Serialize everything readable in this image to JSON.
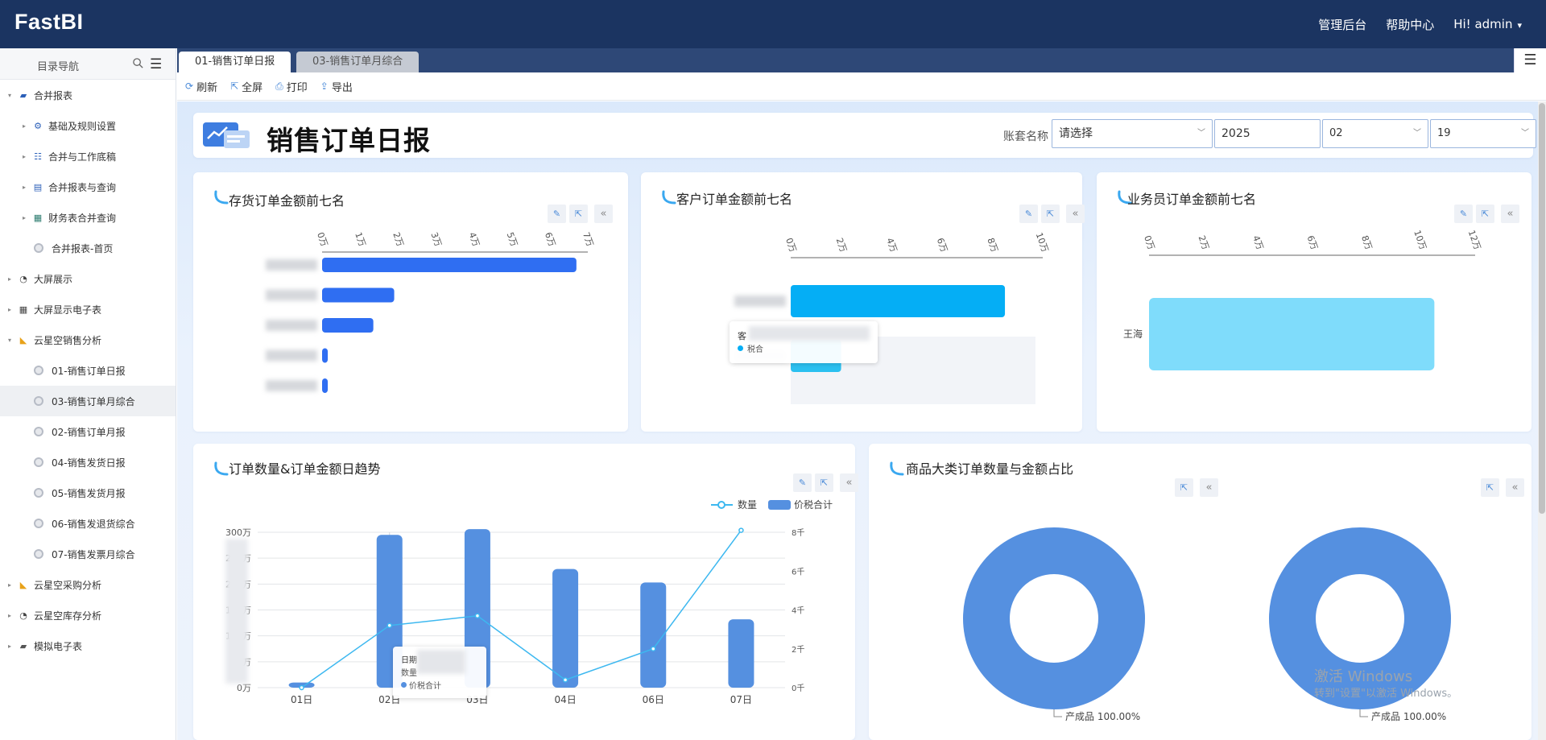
{
  "header": {
    "logo": "FastBI",
    "admin_console": "管理后台",
    "help_center": "帮助中心",
    "greeting": "Hi!  admin"
  },
  "sidebar": {
    "title": "目录导航",
    "items": [
      {
        "label": "合并报表",
        "level": 0,
        "expanded": true,
        "icon": "folder-open-icon"
      },
      {
        "label": "基础及规则设置",
        "level": 1,
        "icon": "gear-icon"
      },
      {
        "label": "合并与工作底稿",
        "level": 1,
        "icon": "sliders-icon"
      },
      {
        "label": "合并报表与查询",
        "level": 1,
        "icon": "document-icon"
      },
      {
        "label": "财务表合并查询",
        "level": 1,
        "icon": "spreadsheet-icon"
      },
      {
        "label": "合并报表-首页",
        "level": 1,
        "icon": "page-icon"
      },
      {
        "label": "大屏展示",
        "level": 0,
        "icon": "pie-chart-icon"
      },
      {
        "label": "大屏显示电子表",
        "level": 0,
        "icon": "grid-icon"
      },
      {
        "label": "云星空销售分析",
        "level": 0,
        "expanded": true,
        "icon": "area-chart-icon"
      },
      {
        "label": "01-销售订单日报",
        "level": 1,
        "icon": "page-icon"
      },
      {
        "label": "03-销售订单月综合",
        "level": 1,
        "icon": "page-icon",
        "selected": true
      },
      {
        "label": "02-销售订单月报",
        "level": 1,
        "icon": "page-icon"
      },
      {
        "label": "04-销售发货日报",
        "level": 1,
        "icon": "page-icon"
      },
      {
        "label": "05-销售发货月报",
        "level": 1,
        "icon": "page-icon"
      },
      {
        "label": "06-销售发退货综合",
        "level": 1,
        "icon": "page-icon"
      },
      {
        "label": "07-销售发票月综合",
        "level": 1,
        "icon": "page-icon"
      },
      {
        "label": "云星空采购分析",
        "level": 0,
        "icon": "area-chart-icon"
      },
      {
        "label": "云星空库存分析",
        "level": 0,
        "icon": "pie-chart-icon"
      },
      {
        "label": "模拟电子表",
        "level": 0,
        "icon": "folder-icon"
      }
    ]
  },
  "tabs": [
    {
      "label": "01-销售订单日报",
      "active": true
    },
    {
      "label": "03-销售订单月综合",
      "active": false
    }
  ],
  "toolbar": {
    "refresh": "刷新",
    "fullscreen": "全屏",
    "print": "打印",
    "export": "导出"
  },
  "report": {
    "title": "销售订单日报",
    "filters": {
      "account_label": "账套名称",
      "account_placeholder": "请选择",
      "year": "2025",
      "month": "02",
      "day": "19"
    }
  },
  "cards": {
    "inventory_title": "存货订单金额前七名",
    "customer_title": "客户订单金额前七名",
    "salesperson_title": "业务员订单金额前七名",
    "trend_title": "订单数量&订单金额日趋势",
    "category_title": "商品大类订单数量与金额占比"
  },
  "tooltips": {
    "customer": {
      "name": "客",
      "series": "税合"
    },
    "trend": {
      "date": "日期",
      "qty": "数量",
      "amount": "价税合计"
    }
  },
  "colors": {
    "header_bg": "#1b3461",
    "tabbar_bg": "#2e4877",
    "bar_blue": "#2f6ef2",
    "bar_cyan": "#05aef5",
    "bar_light_cyan": "#7fdcfb",
    "trend_bar": "#5590e0",
    "trend_line": "#3db8f0",
    "donut": "#5590e0"
  },
  "chart_data": [
    {
      "type": "bar",
      "title": "存货订单金额前七名",
      "orientation": "horizontal",
      "categories": [
        "■■■■机",
        "■■■■",
        "■■■■■",
        "■■■■■线",
        "■■■■■长线"
      ],
      "values": [
        67000,
        19000,
        13500,
        1500,
        1500
      ],
      "xticks": [
        "0万",
        "1万",
        "2万",
        "3万",
        "4万",
        "5万",
        "6万",
        "7万"
      ],
      "xlim": [
        0,
        70000
      ]
    },
    {
      "type": "bar",
      "title": "客户订单金额前七名",
      "orientation": "horizontal",
      "categories": [
        "■■■■■■■■司",
        "■■■■■■■■■■"
      ],
      "values": [
        85000,
        20000
      ],
      "xticks": [
        "0万",
        "2万",
        "4万",
        "6万",
        "8万",
        "10万"
      ],
      "xlim": [
        0,
        100000
      ]
    },
    {
      "type": "bar",
      "title": "业务员订单金额前七名",
      "orientation": "horizontal",
      "categories": [
        "王海"
      ],
      "values": [
        105000
      ],
      "xticks": [
        "0万",
        "2万",
        "4万",
        "6万",
        "8万",
        "10万",
        "12万"
      ],
      "xlim": [
        0,
        120000
      ]
    },
    {
      "type": "bar",
      "title": "订单数量&订单金额日趋势",
      "categories": [
        "01日",
        "02日",
        "03日",
        "04日",
        "06日",
        "07日"
      ],
      "series": [
        {
          "name": "价税合计",
          "kind": "bar",
          "axis": "left",
          "values": [
            100000,
            2950000,
            3060000,
            2290000,
            2030000,
            1320000
          ]
        },
        {
          "name": "数量",
          "kind": "line",
          "axis": "right",
          "values": [
            0,
            3200,
            3700,
            400,
            2000,
            8100
          ]
        }
      ],
      "left_yticks": [
        "0万",
        "50万",
        "100万",
        "150万",
        "200万",
        "250万",
        "300万"
      ],
      "right_yticks": [
        "0千",
        "2千",
        "4千",
        "6千",
        "8千"
      ],
      "legend": [
        "数量",
        "价税合计"
      ],
      "legend_position": "top-right"
    },
    {
      "type": "pie",
      "title": "商品大类订单数量与金额占比",
      "charts": [
        {
          "labels": [
            "产成品"
          ],
          "values": [
            100.0
          ],
          "label_text": "产成品 100.00%"
        },
        {
          "labels": [
            "产成品"
          ],
          "values": [
            100.0
          ],
          "label_text": "产成品 100.00%"
        }
      ]
    }
  ],
  "watermark": {
    "line1": "激活 Windows",
    "line2": "转到\"设置\"以激活 Windows。"
  }
}
